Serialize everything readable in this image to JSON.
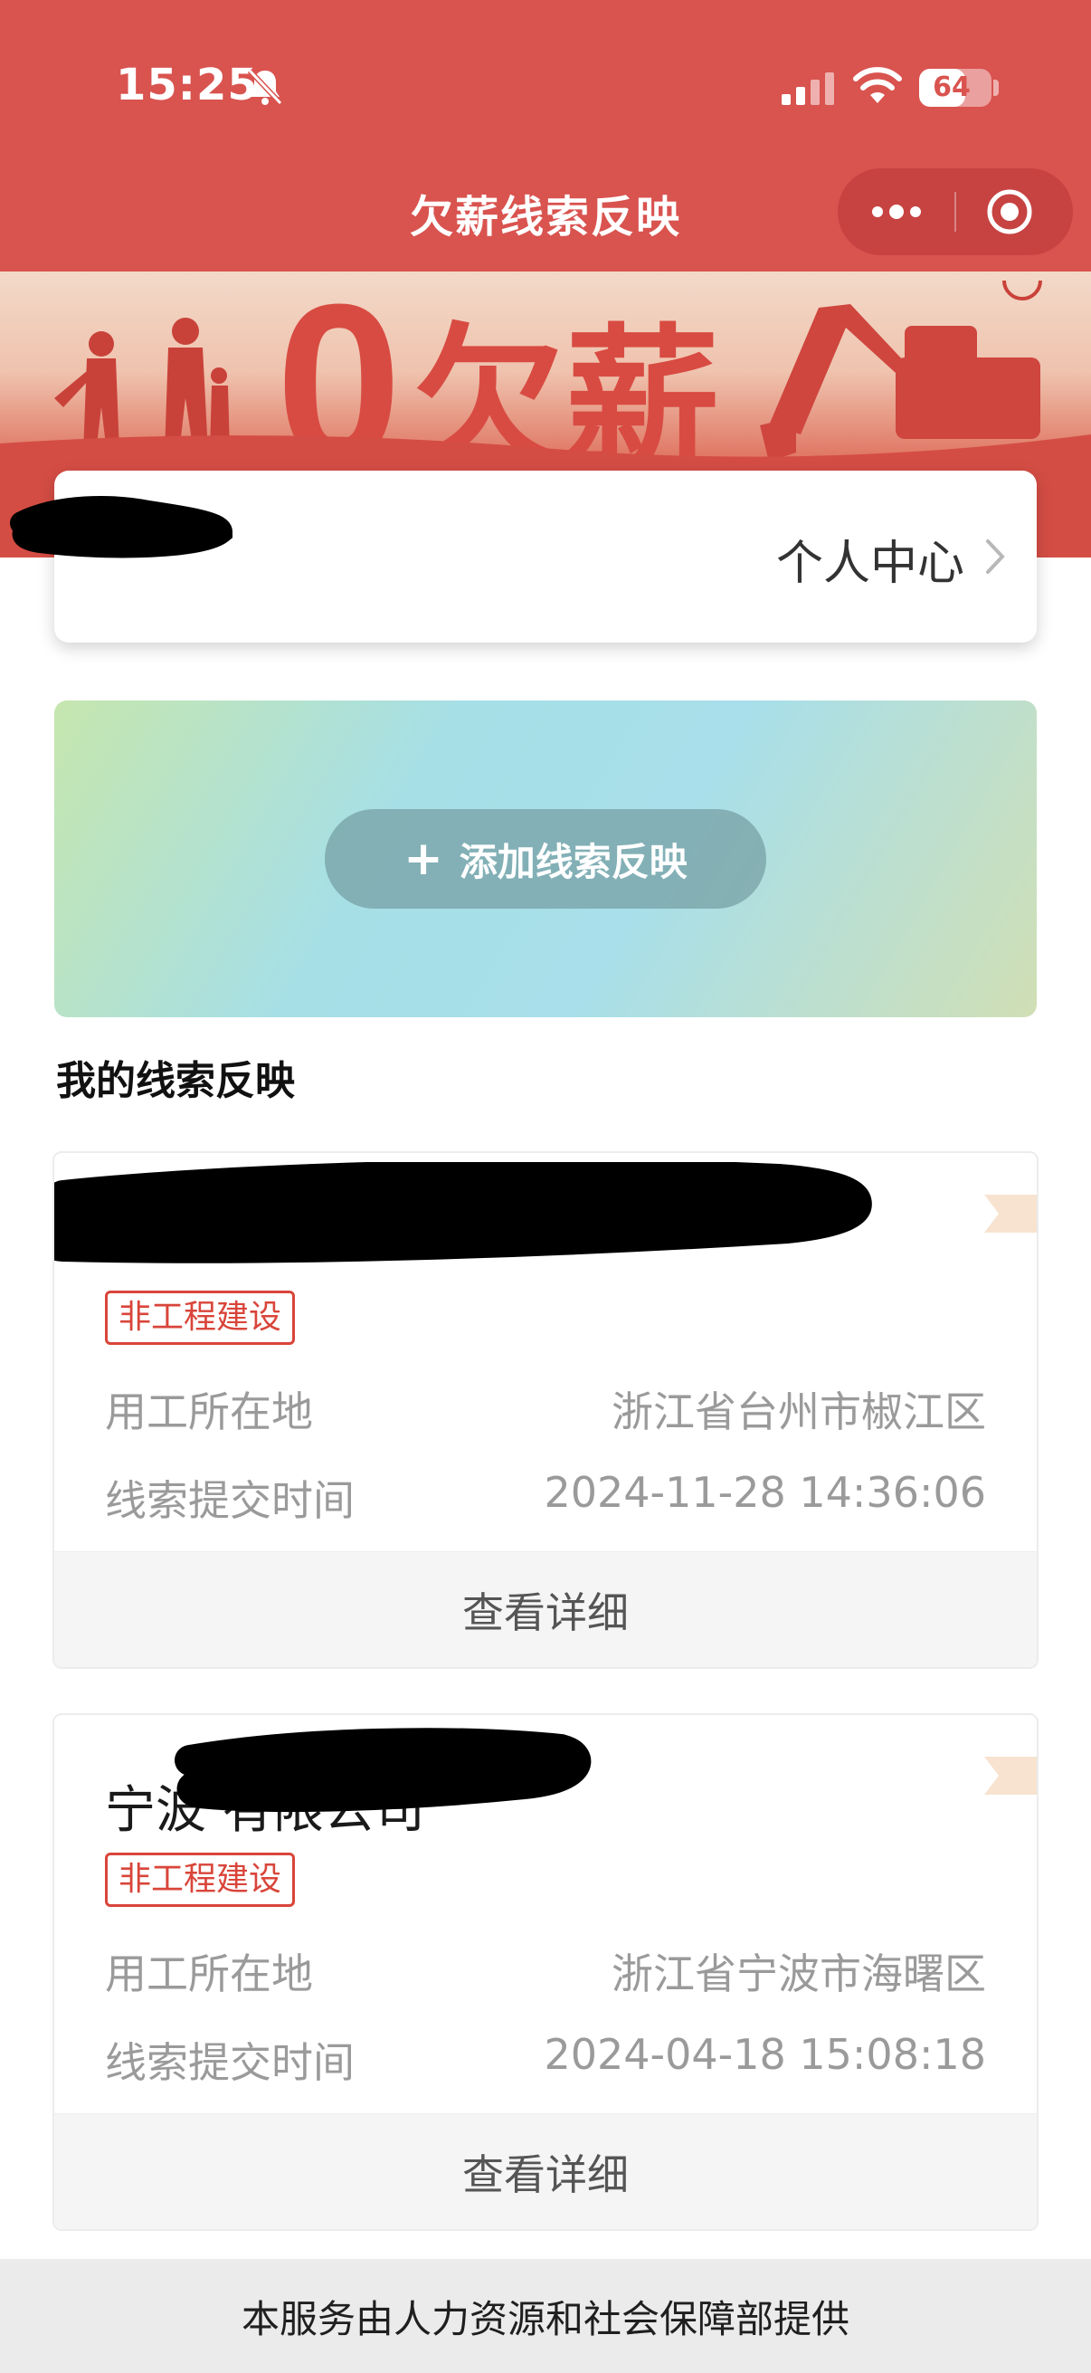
{
  "status_bar": {
    "time": "15:25",
    "battery_level": "64",
    "battery_fraction": 0.64,
    "icons": [
      "bell-muted-icon",
      "signal-icon",
      "wifi-icon",
      "battery-icon"
    ]
  },
  "nav": {
    "title": "欠薪线索反映",
    "capsule_icons": [
      "more-icon",
      "close-target-icon"
    ]
  },
  "banner": {
    "text": "0",
    "overlay": "欠薪"
  },
  "user_card": {
    "center_label": "个人中心"
  },
  "add_panel": {
    "button_label": "添加线索反映"
  },
  "section": {
    "title": "我的线索反映"
  },
  "clues": [
    {
      "company": "",
      "tag": "非工程建设",
      "location_label": "用工所在地",
      "location_value": "浙江省台州市椒江区",
      "time_label": "线索提交时间",
      "time_value": "2024-11-28 14:36:06",
      "detail_label": "查看详细"
    },
    {
      "company": "宁波        有限公司",
      "tag": "非工程建设",
      "location_label": "用工所在地",
      "location_value": "浙江省宁波市海曙区",
      "time_label": "线索提交时间",
      "time_value": "2024-04-18 15:08:18",
      "detail_label": "查看详细"
    }
  ],
  "footer": {
    "text": "本服务由人力资源和社会保障部提供"
  },
  "colors": {
    "header": "#d9534f",
    "tag": "#d9453a",
    "muted_text": "#9a9a9a"
  }
}
